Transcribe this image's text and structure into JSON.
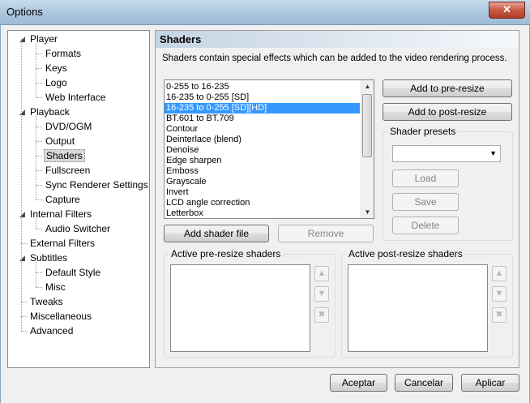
{
  "window": {
    "title": "Options",
    "close_glyph": "✕"
  },
  "tree": [
    {
      "label": "Player",
      "level": 0,
      "expander": "◢"
    },
    {
      "label": "Formats",
      "level": 1
    },
    {
      "label": "Keys",
      "level": 1
    },
    {
      "label": "Logo",
      "level": 1
    },
    {
      "label": "Web Interface",
      "level": 1
    },
    {
      "label": "Playback",
      "level": 0,
      "expander": "◢"
    },
    {
      "label": "DVD/OGM",
      "level": 1
    },
    {
      "label": "Output",
      "level": 1
    },
    {
      "label": "Shaders",
      "level": 1,
      "selected": true
    },
    {
      "label": "Fullscreen",
      "level": 1
    },
    {
      "label": "Sync Renderer Settings",
      "level": 1
    },
    {
      "label": "Capture",
      "level": 1
    },
    {
      "label": "Internal Filters",
      "level": 0,
      "expander": "◢"
    },
    {
      "label": "Audio Switcher",
      "level": 1
    },
    {
      "label": "External Filters",
      "level": 0
    },
    {
      "label": "Subtitles",
      "level": 0,
      "expander": "◢"
    },
    {
      "label": "Default Style",
      "level": 1
    },
    {
      "label": "Misc",
      "level": 1
    },
    {
      "label": "Tweaks",
      "level": 0
    },
    {
      "label": "Miscellaneous",
      "level": 0
    },
    {
      "label": "Advanced",
      "level": 0
    }
  ],
  "page": {
    "header": "Shaders",
    "description": "Shaders contain special effects which can be added to the video rendering process."
  },
  "shader_list": {
    "items": [
      "0-255 to 16-235",
      "16-235 to 0-255 [SD]",
      "16-235 to 0-255 [SD][HD]",
      "BT.601 to BT.709",
      "Contour",
      "Deinterlace (blend)",
      "Denoise",
      "Edge sharpen",
      "Emboss",
      "Grayscale",
      "Invert",
      "LCD angle correction",
      "Letterbox"
    ],
    "selected_index": 2
  },
  "buttons": {
    "add_pre_resize": "Add to pre-resize",
    "add_post_resize": "Add to post-resize",
    "add_shader_file": "Add shader file",
    "remove": "Remove",
    "load": "Load",
    "save": "Save",
    "delete": "Delete",
    "ok": "Aceptar",
    "cancel": "Cancelar",
    "apply": "Aplicar"
  },
  "presets": {
    "label": "Shader presets",
    "value": ""
  },
  "active_pre": {
    "label": "Active pre-resize shaders"
  },
  "active_post": {
    "label": "Active post-resize shaders"
  },
  "icons": {
    "up": "▲",
    "down": "▼",
    "remove": "✖",
    "scroll_up": "▲",
    "scroll_down": "▼",
    "combo_down": "▼"
  }
}
